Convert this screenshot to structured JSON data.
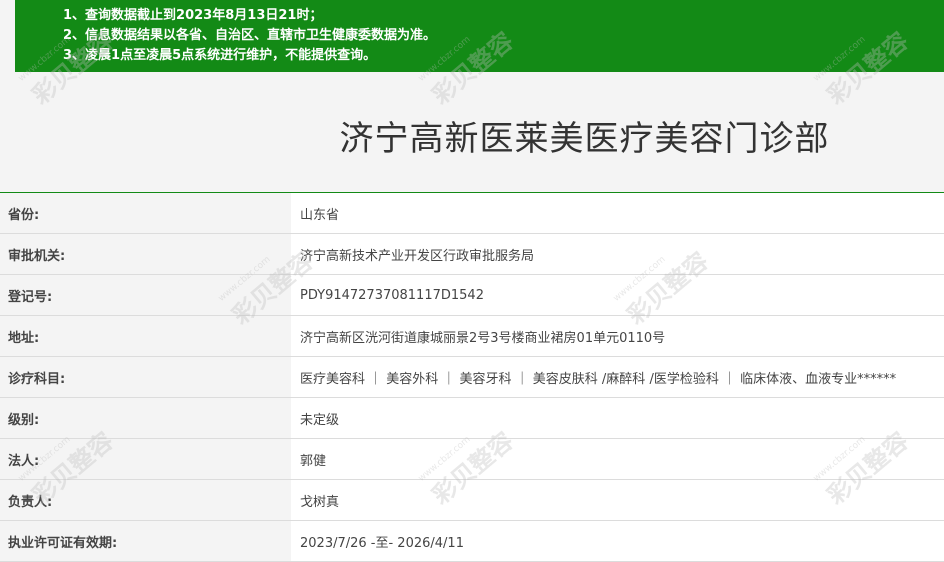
{
  "notice": {
    "items": [
      "1、查询数据截止到2023年8月13日21时；",
      "2、信息数据结果以各省、自治区、直辖市卫生健康委数据为准。",
      "3、凌晨1点至凌晨5点系统进行维护，不能提供查询。"
    ]
  },
  "title": "济宁高新医莱美医疗美容门诊部",
  "rows": [
    {
      "label": "省份:",
      "value": "山东省"
    },
    {
      "label": "审批机关:",
      "value": "济宁高新技术产业开发区行政审批服务局"
    },
    {
      "label": "登记号:",
      "value": "PDY91472737081117D1542"
    },
    {
      "label": "地址:",
      "value": "济宁高新区洸河街道康城丽景2号3号楼商业裙房01单元0110号"
    },
    {
      "label": "诊疗科目:",
      "value": "医疗美容科 ｜ 美容外科 ｜ 美容牙科 ｜ 美容皮肤科 /麻醉科 /医学检验科 ｜ 临床体液、血液专业******"
    },
    {
      "label": "级别:",
      "value": "未定级"
    },
    {
      "label": "法人:",
      "value": "郭健"
    },
    {
      "label": "负责人:",
      "value": "戈树真"
    },
    {
      "label": "执业许可证有效期:",
      "value": "2023/7/26 -至- 2026/4/11"
    }
  ],
  "watermark": {
    "text": "彩贝整容",
    "url": "www.cbzr.com"
  }
}
